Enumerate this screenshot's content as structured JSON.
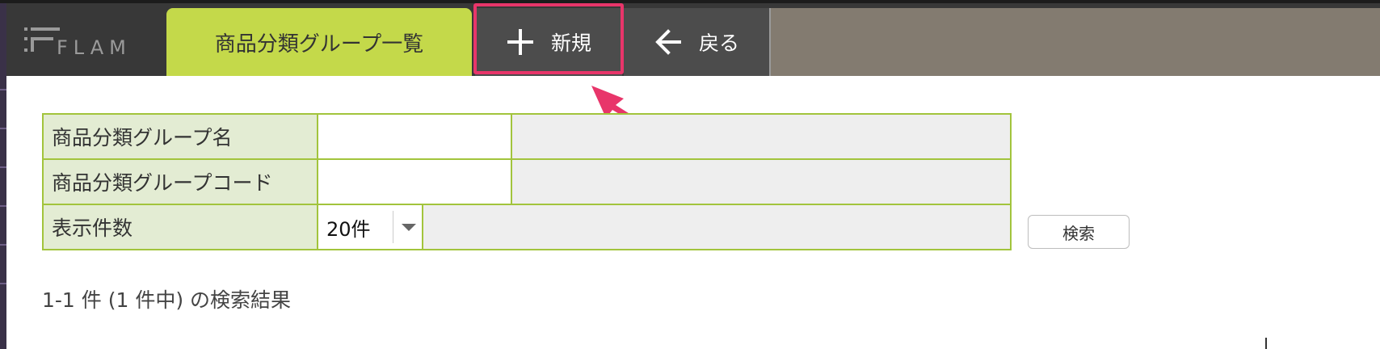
{
  "logo": {
    "text": "FLAM"
  },
  "nav": {
    "current_tab": "商品分類グループ一覧",
    "new_label": "新規",
    "new_icon": "plus-icon",
    "back_label": "戻る",
    "back_icon": "arrow-left-icon"
  },
  "search_form": {
    "rows": [
      {
        "label": "商品分類グループ名",
        "value": ""
      },
      {
        "label": "商品分類グループコード",
        "value": ""
      },
      {
        "label": "表示件数",
        "selected": "20件"
      }
    ],
    "search_button": "検索"
  },
  "result_summary": "1-1 件 (1 件中) の検索結果",
  "colors": {
    "accent_green": "#c4d94a",
    "nav_dark": "#383838",
    "nav_button": "#4c4c4c",
    "nav_fill": "#837b70",
    "highlight_pink": "#e8356a",
    "form_border": "#a2c43c",
    "label_bg": "#e3ecd3"
  }
}
